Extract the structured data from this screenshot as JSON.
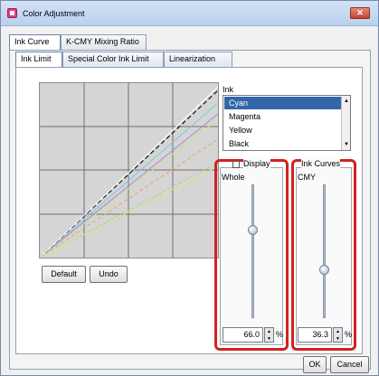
{
  "window": {
    "title": "Color Adjustment",
    "close_label": "✕"
  },
  "top_tabs": [
    {
      "label": "Ink Curve",
      "active": true
    },
    {
      "label": "K-CMY Mixing Ratio",
      "active": false
    }
  ],
  "sub_tabs": [
    {
      "label": "Ink Limit",
      "active": true
    },
    {
      "label": "Special Color Ink Limit",
      "active": false
    },
    {
      "label": "Linearization",
      "active": false
    }
  ],
  "graph": {
    "default_button": "Default",
    "undo_button": "Undo"
  },
  "ink": {
    "label": "Ink",
    "items": [
      "Cyan",
      "Magenta",
      "Yellow",
      "Black"
    ],
    "selected": "Cyan"
  },
  "display_checkbox_label": "Display",
  "ink_curves_label": "Ink Curves",
  "whole": {
    "title": "Whole",
    "value": "66.0",
    "unit": "%",
    "slider_level": 0.66
  },
  "cmy": {
    "title": "CMY",
    "value": "36.3",
    "unit": "%",
    "slider_level": 0.363
  },
  "footer": {
    "ok_label": "OK",
    "cancel_label": "Cancel"
  },
  "colors": {
    "selection": "#3366a8",
    "highlight_border": "#d42020",
    "cyan_line": "#7ec8e0",
    "magenta_line": "#c080e0",
    "yellow_line": "#e0e060",
    "black_line": "#202020"
  }
}
